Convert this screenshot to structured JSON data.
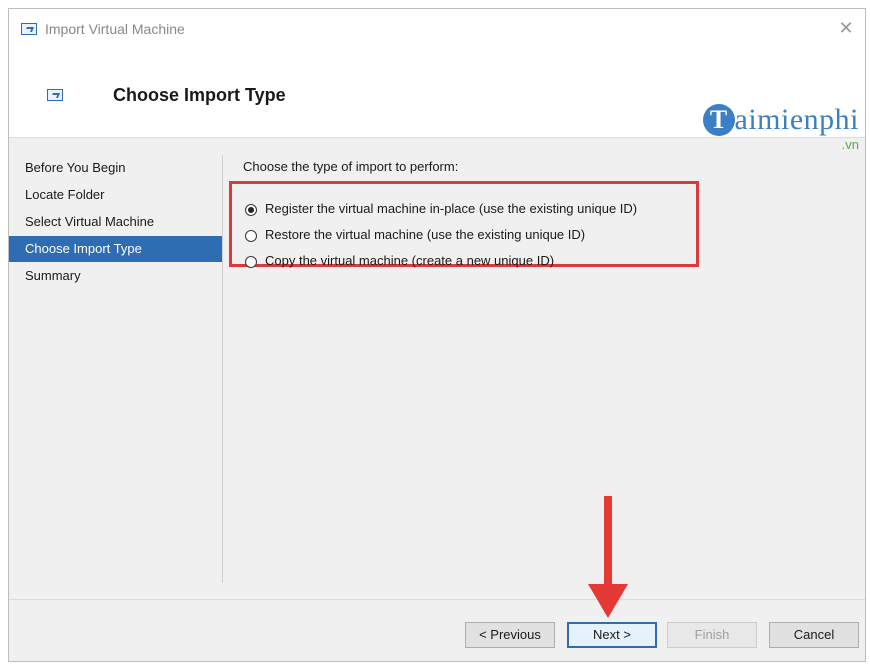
{
  "window": {
    "title": "Import Virtual Machine",
    "close_glyph": "✕",
    "icon": "vm-import-icon"
  },
  "header": {
    "title": "Choose Import Type",
    "icon": "vm-import-icon"
  },
  "watermark": {
    "logo_letter": "T",
    "text": "aimienphi",
    "suffix": ".vn"
  },
  "sidebar": {
    "items": [
      {
        "label": "Before You Begin",
        "active": false
      },
      {
        "label": "Locate Folder",
        "active": false
      },
      {
        "label": "Select Virtual Machine",
        "active": false
      },
      {
        "label": "Choose Import Type",
        "active": true
      },
      {
        "label": "Summary",
        "active": false
      }
    ]
  },
  "content": {
    "prompt": "Choose the type of import to perform:",
    "options": [
      {
        "label": "Register the virtual machine in-place (use the existing unique ID)",
        "checked": true
      },
      {
        "label": "Restore the virtual machine (use the existing unique ID)",
        "checked": false
      },
      {
        "label": "Copy the virtual machine (create a new unique ID)",
        "checked": false
      }
    ]
  },
  "footer": {
    "previous_label": "< Previous",
    "next_label": "Next >",
    "finish_label": "Finish",
    "cancel_label": "Cancel"
  },
  "colors": {
    "accent": "#2e6db4",
    "highlight": "#d93b3b",
    "arrow": "#e53935"
  }
}
